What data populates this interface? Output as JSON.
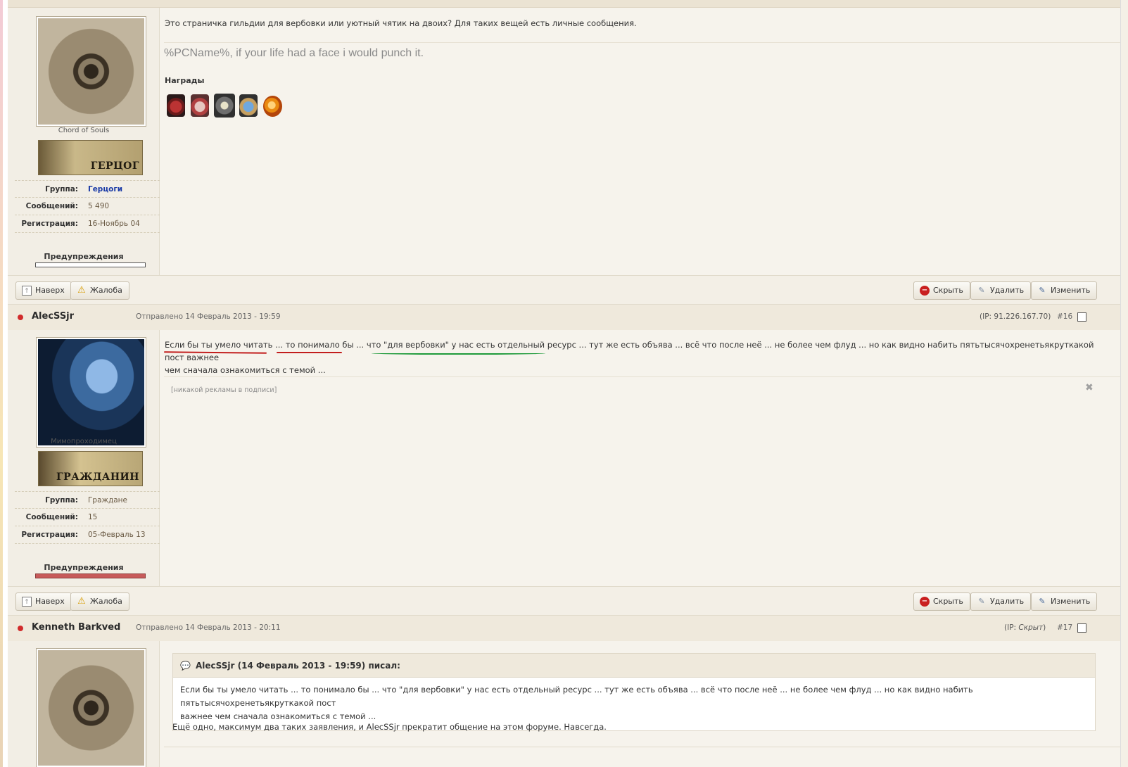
{
  "post1": {
    "username": "Chord of Souls",
    "rank_text": "ГЕРЦОГ",
    "group_label": "Группа:",
    "group_value": "Герцоги",
    "posts_label": "Сообщений:",
    "posts_value": "5 490",
    "reg_label": "Регистрация:",
    "reg_value": "16-Ноябрь 04",
    "warnings_label": "Предупреждения",
    "body": "Это страничка гильдии для вербовки или уютный чятик на двоих? Для таких вещей есть личные сообщения.",
    "signature": "%PCName%, if your life had a face i would punch it.",
    "awards_label": "Награды"
  },
  "actions": {
    "top_label": "Наверх",
    "report_label": "Жалоба",
    "hide_label": "Скрыть",
    "delete_label": "Удалить",
    "edit_label": "Изменить"
  },
  "post2": {
    "author": "AlecSSjr",
    "sent": "Отправлено 14 Февраль 2013 - 19:59",
    "ip": "(IP: 91.226.167.70)",
    "number": "#16",
    "username": "Мимопроходимец",
    "rank_text": "ГРАЖДАНИН",
    "group_label": "Группа:",
    "group_value": "Граждане",
    "posts_label": "Сообщений:",
    "posts_value": "15",
    "reg_label": "Регистрация:",
    "reg_value": "05-Февраль 13",
    "warnings_label": "Предупреждения",
    "body_line1": "Если бы ты умело читать ... то понимало бы ... что \"для вербовки\" у нас есть отдельный ресурс ... тут же есть объява ... всё что после неё ... не более чем флуд ... но как видно набить пятьтысячохренетьякруткакой пост важнее",
    "body_line2": "чем сначала ознакомиться с темой ...",
    "ad_note": "[никакой рекламы в подписи]"
  },
  "post3": {
    "author": "Kenneth Barkved",
    "sent": "Отправлено 14 Февраль 2013 - 20:11",
    "ip_prefix": "(IP: ",
    "ip_value": "Скрыт",
    "ip_suffix": ")",
    "number": "#17",
    "quote_header": "AlecSSjr (14 Февраль 2013 - 19:59) писал:",
    "quote_line1": "Если бы ты умело читать ... то понимало бы ... что \"для вербовки\" у нас есть отдельный ресурс ... тут же есть объява ... всё что после неё ... не более чем флуд ... но как видно набить пятьтысячохренетьякруткакой пост",
    "quote_line2": "важнее чем сначала ознакомиться с темой ...",
    "reply": "Ещё одно, максимум два таких заявления, и AlecSSjr прекратит общение на этом форуме. Навсегда."
  },
  "colors": {
    "underline_red": "#c21d1d",
    "underline_green": "#1e9a3a",
    "status_dot": "#d12b2b"
  }
}
